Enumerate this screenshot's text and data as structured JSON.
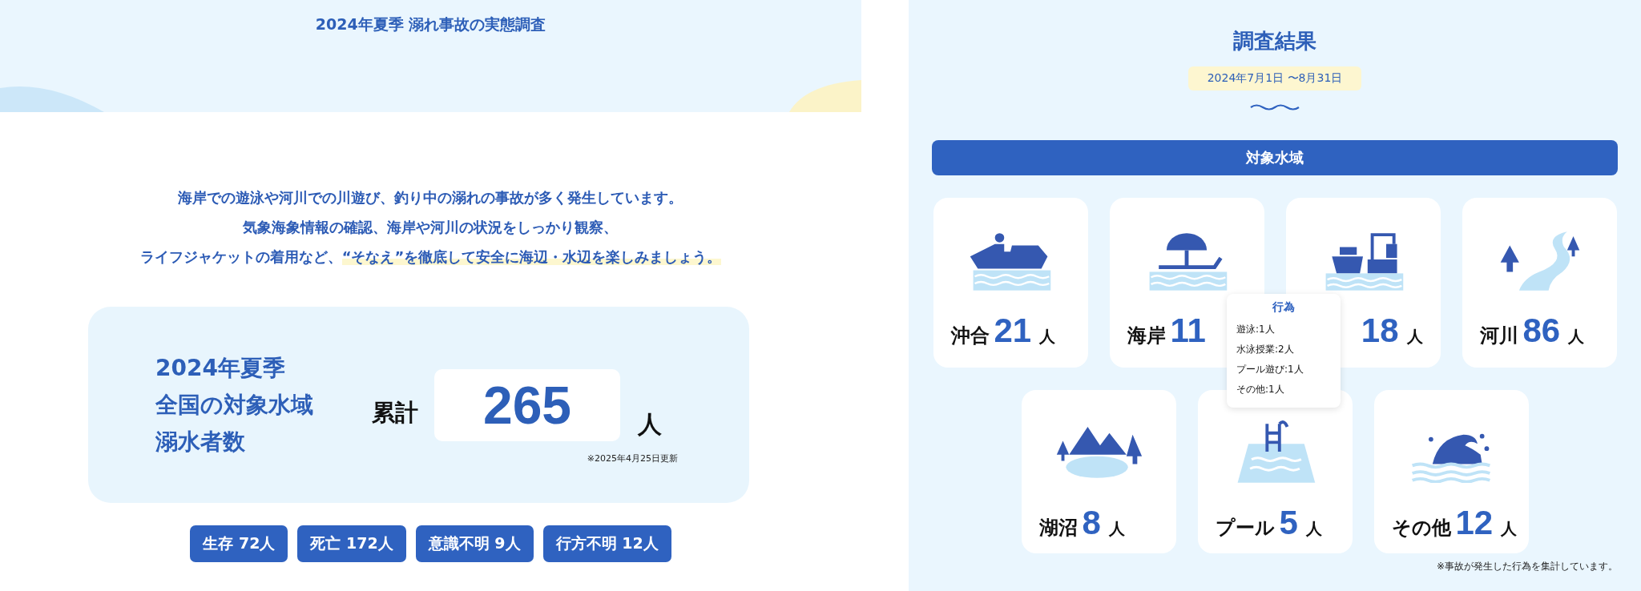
{
  "left": {
    "header_title": "2024年夏季 溺れ事故の実態調査",
    "intro": {
      "lines": [
        "海岸での遊泳や河川での川遊び、釣り中の溺れの事故が多く発生しています。",
        "気象海象情報の確認、海岸や河川の状況をしっかり観察、"
      ],
      "last_line": "ライフジャケットの着用など、",
      "highlight": "“そなえ”を徹底して安全に海辺・水辺を楽しみましょう。"
    },
    "stats": {
      "label_lines": [
        "2024年夏季",
        "全国の対象水域",
        "溺水者数"
      ],
      "total_label": "累計",
      "total": "265",
      "unit": "人",
      "updated": "※2025年4月25日更新"
    },
    "badges": [
      "生存 72人",
      "死亡 172人",
      "意識不明 9人",
      "行方不明 12人"
    ]
  },
  "right": {
    "title": "調査結果",
    "period": "2024年7月1日 〜8月31日",
    "section": "対象水域",
    "areas": [
      {
        "kind": "offshore",
        "label": "沖合",
        "count": "21",
        "unit": "人"
      },
      {
        "kind": "beach",
        "label": "海岸",
        "count": "11"
      },
      {
        "kind": "port",
        "count": "18",
        "unit": "人"
      },
      {
        "kind": "river",
        "label": "河川",
        "count": "86",
        "unit": "人"
      },
      {
        "kind": "lake",
        "label": "湖沼",
        "count": "8",
        "unit": "人"
      },
      {
        "kind": "pool",
        "label": "プール",
        "count": "5",
        "unit": "人"
      },
      {
        "kind": "other",
        "label": "その他",
        "count": "12",
        "unit": "人"
      }
    ],
    "tooltip": {
      "title": "行為",
      "items": [
        "遊泳:1人",
        "水泳授業:2人",
        "プール遊び:1人",
        "その他:1人"
      ]
    },
    "note": "※事故が発生した行為を集計しています。"
  }
}
